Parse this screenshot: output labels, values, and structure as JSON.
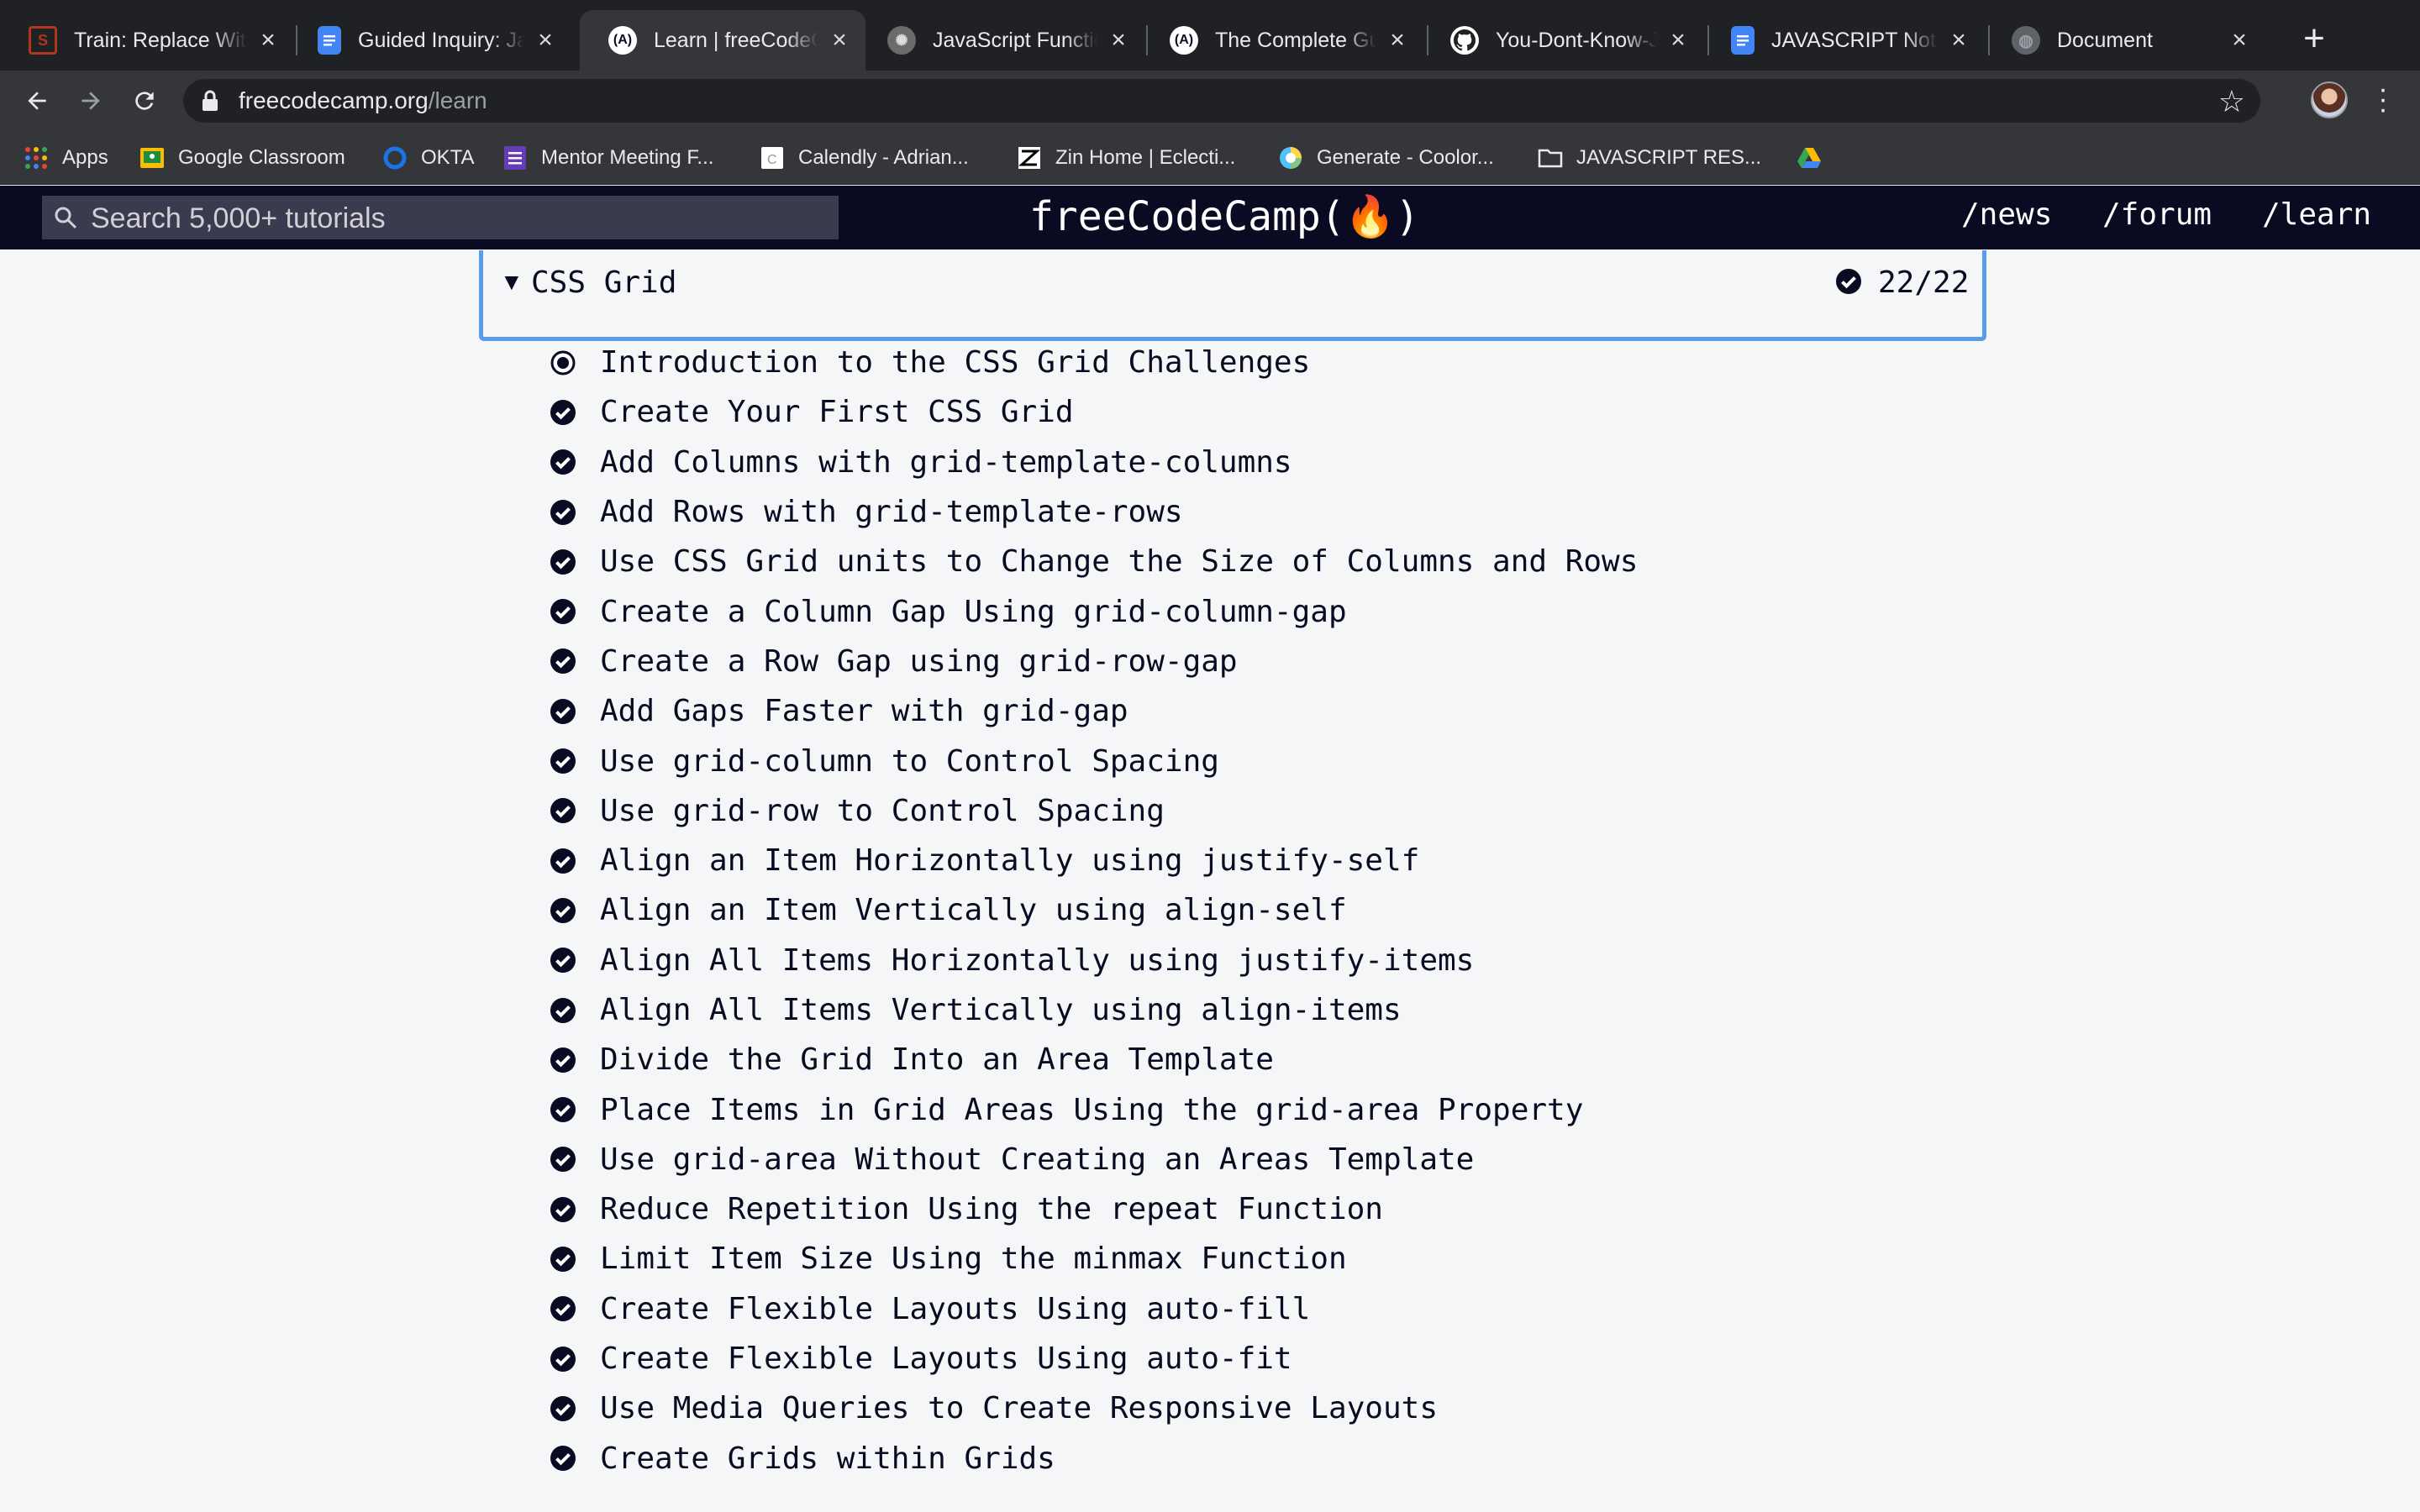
{
  "browser": {
    "tabs": [
      {
        "title": "Train: Replace With",
        "icon": "codewars-icon",
        "active": false
      },
      {
        "title": "Guided Inquiry: Ja",
        "icon": "google-docs-icon",
        "active": false
      },
      {
        "title": "Learn | freeCodeC",
        "icon": "freecodecamp-icon",
        "active": true
      },
      {
        "title": "JavaScript Functio",
        "icon": "web-icon",
        "active": false
      },
      {
        "title": "The Complete Gui",
        "icon": "freecodecamp-icon",
        "active": false
      },
      {
        "title": "You-Dont-Know-J",
        "icon": "github-icon",
        "active": false
      },
      {
        "title": "JAVASCRIPT Note",
        "icon": "google-docs-icon",
        "active": false
      },
      {
        "title": "Document",
        "icon": "globe-icon",
        "active": false
      }
    ],
    "url_domain": "freecodecamp.org",
    "url_path": "/learn",
    "bookmarks": [
      {
        "label": "Apps",
        "icon": "apps-grid-icon"
      },
      {
        "label": "Google Classroom",
        "icon": "google-classroom-icon"
      },
      {
        "label": "OKTA",
        "icon": "okta-icon"
      },
      {
        "label": "Mentor Meeting F...",
        "icon": "forms-icon"
      },
      {
        "label": "Calendly - Adrian...",
        "icon": "calendly-icon"
      },
      {
        "label": "Zin Home | Eclecti...",
        "icon": "zin-icon"
      },
      {
        "label": "Generate - Coolor...",
        "icon": "coolors-icon"
      },
      {
        "label": "JAVASCRIPT RES...",
        "icon": "folder-icon"
      },
      {
        "label": "",
        "icon": "google-drive-icon"
      }
    ]
  },
  "fcc": {
    "search_placeholder": "Search 5,000+ tutorials",
    "logo": "freeCodeCamp(🔥)",
    "nav": [
      "/news",
      "/forum",
      "/learn"
    ]
  },
  "block": {
    "title": "CSS Grid",
    "count": "22/22",
    "challenges": [
      {
        "title": "Introduction to the CSS Grid Challenges",
        "status": "intro"
      },
      {
        "title": "Create Your First CSS Grid",
        "status": "completed"
      },
      {
        "title": "Add Columns with grid-template-columns",
        "status": "completed"
      },
      {
        "title": "Add Rows with grid-template-rows",
        "status": "completed"
      },
      {
        "title": "Use CSS Grid units to Change the Size of Columns and Rows",
        "status": "completed"
      },
      {
        "title": "Create a Column Gap Using grid-column-gap",
        "status": "completed"
      },
      {
        "title": "Create a Row Gap using grid-row-gap",
        "status": "completed"
      },
      {
        "title": "Add Gaps Faster with grid-gap",
        "status": "completed"
      },
      {
        "title": "Use grid-column to Control Spacing",
        "status": "completed"
      },
      {
        "title": "Use grid-row to Control Spacing",
        "status": "completed"
      },
      {
        "title": "Align an Item Horizontally using justify-self",
        "status": "completed"
      },
      {
        "title": "Align an Item Vertically using align-self",
        "status": "completed"
      },
      {
        "title": "Align All Items Horizontally using justify-items",
        "status": "completed"
      },
      {
        "title": "Align All Items Vertically using align-items",
        "status": "completed"
      },
      {
        "title": "Divide the Grid Into an Area Template",
        "status": "completed"
      },
      {
        "title": "Place Items in Grid Areas Using the grid-area Property",
        "status": "completed"
      },
      {
        "title": "Use grid-area Without Creating an Areas Template",
        "status": "completed"
      },
      {
        "title": "Reduce Repetition Using the repeat Function",
        "status": "completed"
      },
      {
        "title": "Limit Item Size Using the minmax Function",
        "status": "completed"
      },
      {
        "title": "Create Flexible Layouts Using auto-fill",
        "status": "completed"
      },
      {
        "title": "Create Flexible Layouts Using auto-fit",
        "status": "completed"
      },
      {
        "title": "Use Media Queries to Create Responsive Layouts",
        "status": "completed"
      },
      {
        "title": "Create Grids within Grids",
        "status": "completed"
      }
    ]
  },
  "colors": {
    "fcc_nav_bg": "#0a0a23",
    "page_bg": "#f5f6f7",
    "focus_outline": "#5c9aea",
    "text": "#0a0a23"
  }
}
